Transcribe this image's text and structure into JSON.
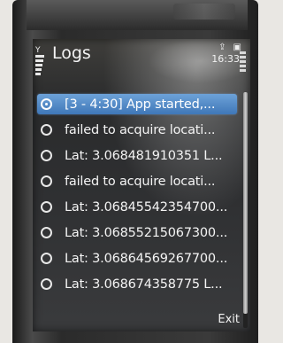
{
  "screen": {
    "title": "Logs",
    "clock": "16:33",
    "softkey_right": "Exit"
  },
  "log_items": [
    {
      "label": "[3 - 4:30] App started,...",
      "selected": true
    },
    {
      "label": "failed to acquire locati...",
      "selected": false
    },
    {
      "label": "Lat: 3.068481910351 L...",
      "selected": false
    },
    {
      "label": "failed to acquire locati...",
      "selected": false
    },
    {
      "label": "Lat: 3.06845542354700...",
      "selected": false
    },
    {
      "label": "Lat: 3.06855215067300...",
      "selected": false
    },
    {
      "label": "Lat: 3.06864569267700...",
      "selected": false
    },
    {
      "label": "Lat: 3.068674358775 L...",
      "selected": false
    }
  ],
  "icons": {
    "signal": "signal-strength-icon",
    "data_transfer": "data-transfer-icon",
    "network": "network-status-icon",
    "battery": "battery-level-icon"
  },
  "colors": {
    "selection": "#4f87c6",
    "text": "#f4f4f4",
    "background": "#2f3032"
  }
}
